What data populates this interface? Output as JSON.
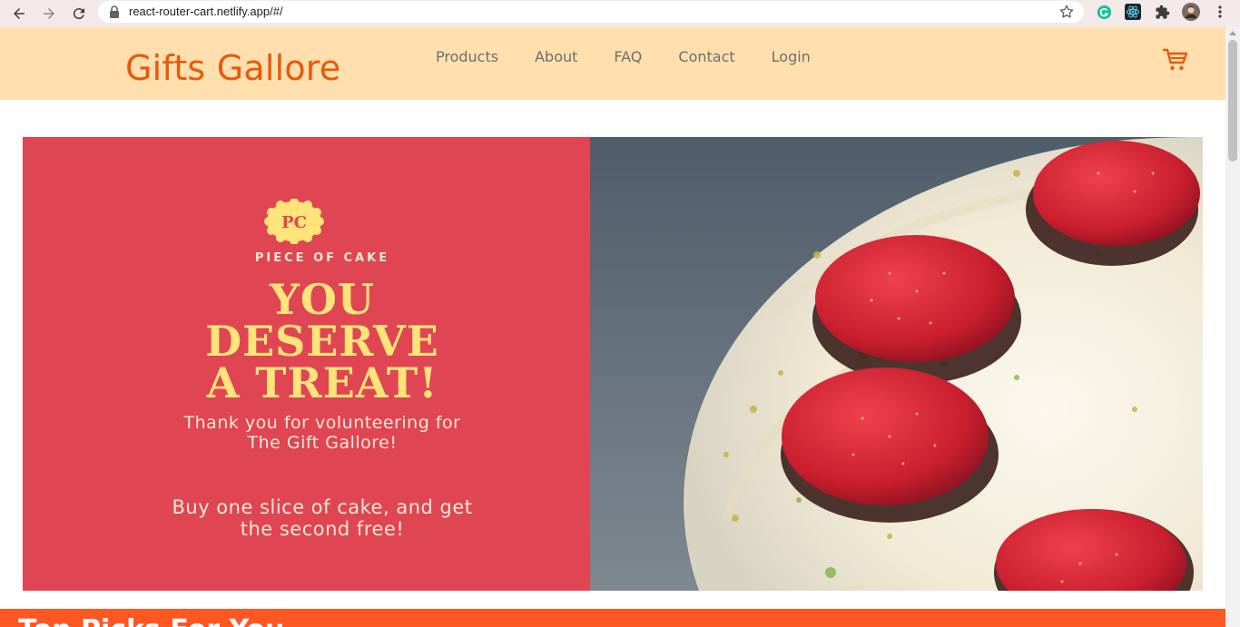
{
  "browser": {
    "url": "react-router-cart.netlify.app/#/",
    "icons": [
      "back-icon",
      "forward-icon",
      "reload-icon",
      "lock-icon",
      "bookmark-star-icon",
      "grammarly-icon",
      "react-devtools-icon",
      "extensions-icon",
      "profile-avatar",
      "more-menu-icon"
    ]
  },
  "header": {
    "logo": "Gifts Gallore",
    "nav": [
      "Products",
      "About",
      "FAQ",
      "Contact",
      "Login"
    ],
    "cart_icon": "cart-icon",
    "accent": "#e8590c",
    "background": "#ffdfae"
  },
  "hero": {
    "badge": "PC",
    "brand": "PIECE OF CAKE",
    "headline": [
      "YOU",
      "DESERVE",
      "A TREAT!"
    ],
    "thanks": [
      "Thank you for volunteering for",
      "The Gift Gallore!"
    ],
    "offer": [
      "Buy one slice of cake, and get",
      "the second free!"
    ],
    "left_color": "#e04553",
    "headline_color": "#ffe47a"
  },
  "next_section": {
    "title": "Top Picks For You",
    "color": "#ff5722"
  }
}
